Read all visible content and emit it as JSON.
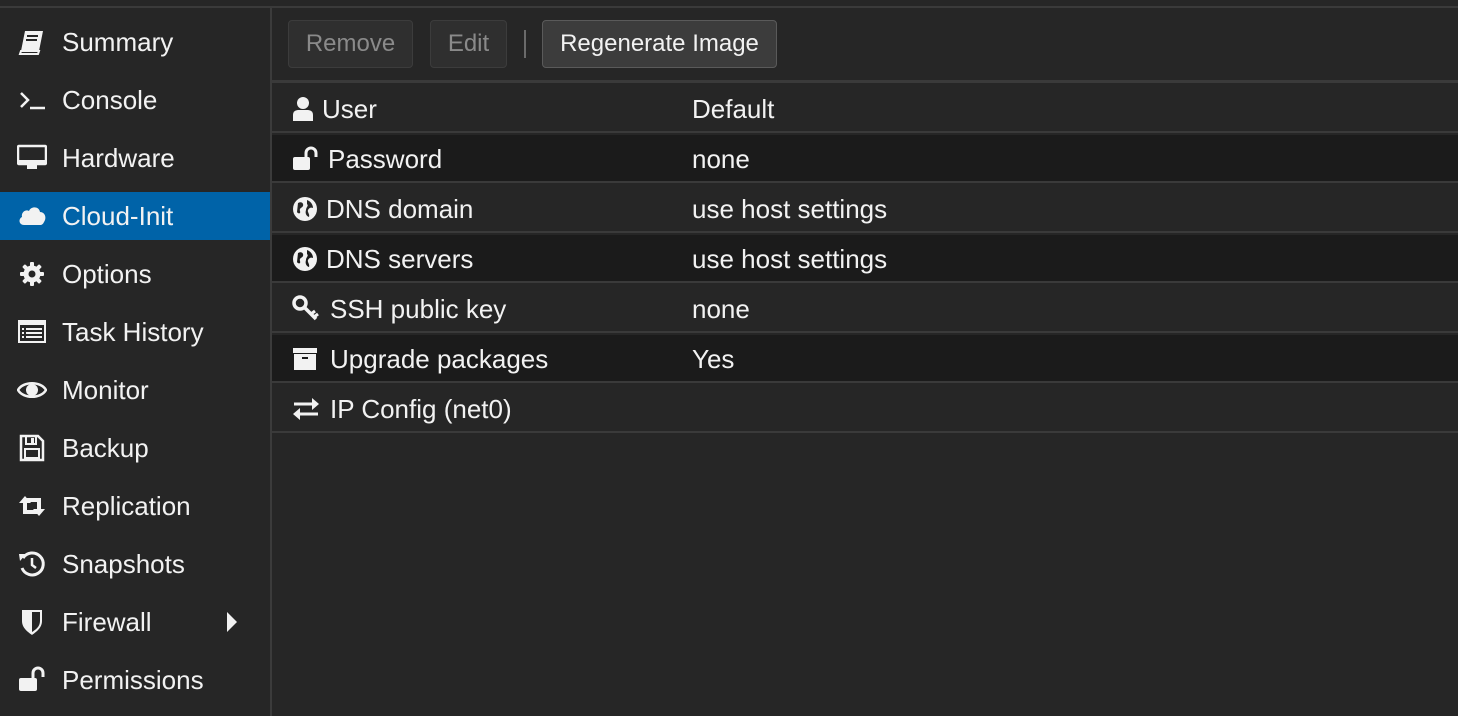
{
  "sidebar": {
    "items": [
      {
        "label": "Summary",
        "icon": "book-icon"
      },
      {
        "label": "Console",
        "icon": "terminal-icon"
      },
      {
        "label": "Hardware",
        "icon": "desktop-icon"
      },
      {
        "label": "Cloud-Init",
        "icon": "cloud-icon",
        "active": true
      },
      {
        "label": "Options",
        "icon": "gear-icon"
      },
      {
        "label": "Task History",
        "icon": "list-icon"
      },
      {
        "label": "Monitor",
        "icon": "eye-icon"
      },
      {
        "label": "Backup",
        "icon": "floppy-icon"
      },
      {
        "label": "Replication",
        "icon": "retweet-icon"
      },
      {
        "label": "Snapshots",
        "icon": "history-icon"
      },
      {
        "label": "Firewall",
        "icon": "shield-icon",
        "has_submenu": true
      },
      {
        "label": "Permissions",
        "icon": "unlock-icon"
      }
    ]
  },
  "toolbar": {
    "remove_label": "Remove",
    "edit_label": "Edit",
    "regenerate_label": "Regenerate Image"
  },
  "grid": {
    "rows": [
      {
        "key": "User",
        "value": "Default",
        "icon": "user-icon"
      },
      {
        "key": "Password",
        "value": "none",
        "icon": "unlock-icon"
      },
      {
        "key": "DNS domain",
        "value": "use host settings",
        "icon": "globe-icon"
      },
      {
        "key": "DNS servers",
        "value": "use host settings",
        "icon": "globe-icon"
      },
      {
        "key": "SSH public key",
        "value": "none",
        "icon": "key-icon"
      },
      {
        "key": "Upgrade packages",
        "value": "Yes",
        "icon": "archive-icon"
      },
      {
        "key": "IP Config (net0)",
        "value": "",
        "icon": "exchange-icon"
      }
    ]
  },
  "colors": {
    "background": "#262626",
    "active_item": "#0063a8",
    "alt_row": "#1b1b1b",
    "text": "#f2f2f2"
  }
}
